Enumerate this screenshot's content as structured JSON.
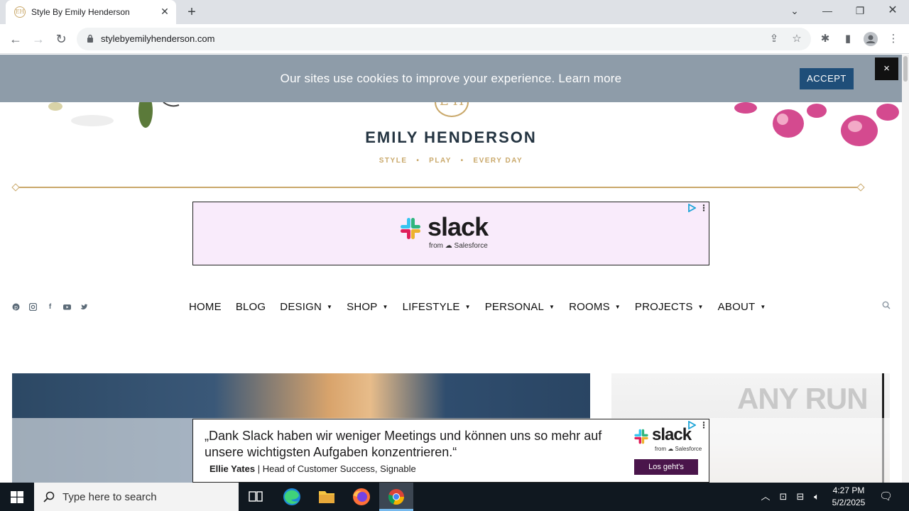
{
  "browser": {
    "tab_title": "Style By Emily Henderson",
    "tab_favicon": "EH",
    "url": "stylebyemilyhenderson.com"
  },
  "cookie": {
    "text": "Our sites use cookies to improve your experience. Learn more",
    "accept_label": "ACCEPT",
    "close_label": "×"
  },
  "brand": {
    "monogram": "E H",
    "name": "EMILY HENDERSON",
    "tagline": "STYLE   •   PLAY   •   EVERY DAY"
  },
  "ad_top": {
    "wordmark": "slack",
    "from_text": "from ☁ Salesforce"
  },
  "nav": {
    "items": [
      {
        "label": "HOME",
        "has_caret": false
      },
      {
        "label": "BLOG",
        "has_caret": false
      },
      {
        "label": "DESIGN",
        "has_caret": true
      },
      {
        "label": "SHOP",
        "has_caret": true
      },
      {
        "label": "LIFESTYLE",
        "has_caret": true
      },
      {
        "label": "PERSONAL",
        "has_caret": true
      },
      {
        "label": "ROOMS",
        "has_caret": true
      },
      {
        "label": "PROJECTS",
        "has_caret": true
      },
      {
        "label": "ABOUT",
        "has_caret": true
      }
    ],
    "caret": "▼"
  },
  "ad_bottom": {
    "quote": "„Dank Slack haben wir weniger Meetings und können uns so mehr auf unsere wichtigsten Aufgaben konzentrieren.“",
    "person_name": "Ellie Yates",
    "person_role": " | Head of Customer Success, Signable",
    "wordmark": "slack",
    "from_text": "from ☁ Salesforce",
    "cta": "Los geht's"
  },
  "watermark": "ANY RUN",
  "taskbar": {
    "search_placeholder": "Type here to search",
    "time": "4:27 PM",
    "date": "5/2/2025"
  },
  "colors": {
    "accent_gold": "#c9a86a",
    "cookie_bar": "#8e9ca9",
    "accept_button": "#1f4e79",
    "slack_purple": "#4a154b"
  }
}
